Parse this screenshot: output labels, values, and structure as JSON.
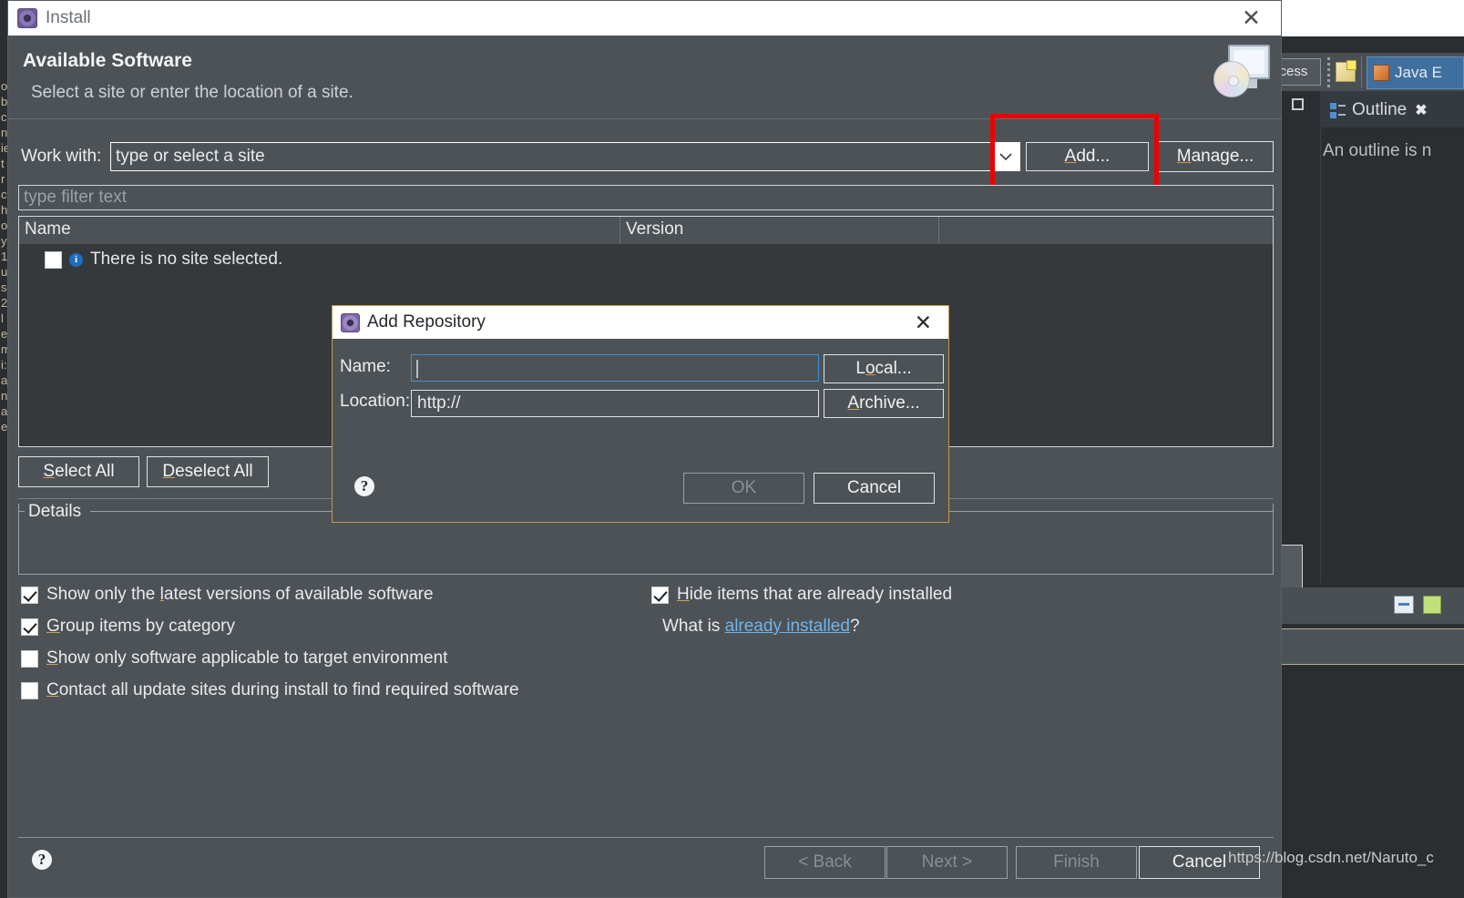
{
  "background_ide": {
    "quick_access": "ccess",
    "perspective_tab": "Java E",
    "outline": {
      "tab_label": "Outline",
      "close_glyph": "✖",
      "message": "An outline is n"
    },
    "left_sliver_text": [
      "o",
      "b",
      "",
      "c",
      "n",
      "",
      "ie",
      "t",
      "r",
      "c",
      "h",
      "o.",
      "",
      "y",
      "1",
      "u",
      "s",
      "2",
      "l",
      "",
      "e",
      "m",
      "i:",
      "a",
      "n",
      "a",
      "e"
    ]
  },
  "wizard": {
    "title": "Install",
    "close_glyph": "✕",
    "heading": "Available Software",
    "subheading": "Select a site or enter the location of a site.",
    "work_with": {
      "label": "Work with:",
      "value": "type or select a site",
      "dropdown_icon": "chevron-down-icon"
    },
    "add_button": {
      "prefix": "A",
      "rest": "dd..."
    },
    "manage_button": {
      "prefix": "M",
      "rest": "anage..."
    },
    "filter_placeholder": "type filter text",
    "table": {
      "columns": [
        "Name",
        "Version",
        ""
      ],
      "rows": [
        {
          "checked": false,
          "icon": "info-icon",
          "text": "There is no site selected."
        }
      ]
    },
    "select_all_button": {
      "prefix": "S",
      "rest": "elect All"
    },
    "deselect_all_button": {
      "prefix": "D",
      "rest": "eselect All"
    },
    "details_legend": "Details",
    "options": [
      {
        "checked": true,
        "pre": "Show only the ",
        "mn": "l",
        "post": "atest versions of available software"
      },
      {
        "checked": true,
        "pre": "",
        "mn": "G",
        "post": "roup items by category"
      },
      {
        "checked": false,
        "pre": "",
        "mn": "S",
        "post": "how only software applicable to target environment"
      },
      {
        "checked": false,
        "pre": "",
        "mn": "C",
        "post": "ontact all update sites during install to find required software"
      },
      {
        "checked": true,
        "pre": "",
        "mn": "H",
        "post": "ide items that are already installed"
      }
    ],
    "already_installed": {
      "lead": "What is ",
      "link": "already installed",
      "tail": "?"
    },
    "help_glyph": "?",
    "footer_buttons": [
      {
        "label": "< Back",
        "disabled": true
      },
      {
        "label": "Next >",
        "disabled": true
      },
      {
        "label": "Finish",
        "disabled": true
      },
      {
        "label": "Cancel",
        "disabled": false
      }
    ]
  },
  "modal": {
    "title": "Add Repository",
    "close_glyph": "✕",
    "name_label": "Name:",
    "name_value": "",
    "location_label": "Location:",
    "location_value": "http://",
    "local_button": {
      "pre": "L",
      "mn": "o",
      "post": "cal..."
    },
    "archive_button": {
      "pre": "",
      "mn": "A",
      "post": "rchive..."
    },
    "help_glyph": "?",
    "ok_button": {
      "label": "OK",
      "disabled": true
    },
    "cancel_button": {
      "label": "Cancel",
      "disabled": false
    }
  },
  "watermark": "https://blog.csdn.net/Naruto_c",
  "colors": {
    "window_bg": "#4d5256",
    "titlebar_bg": "#ffffff",
    "table_bg": "#36393c",
    "accent_link": "#6fb4e8",
    "mnemonic_underline": "#d59b4a",
    "annotation_red": "#ee0000",
    "modal_border": "#c29a4e",
    "focus_border": "#3d8fd8"
  }
}
